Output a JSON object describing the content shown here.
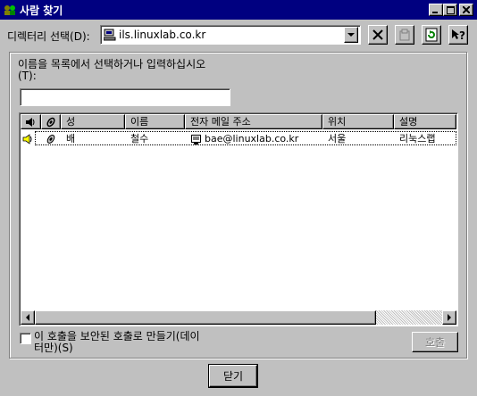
{
  "window": {
    "title": "사람 찾기"
  },
  "directory": {
    "label": "디렉터리 선택(D):",
    "value": "ils.linuxlab.co.kr"
  },
  "search": {
    "label": "이름을 목록에서 선택하거나 입력하십시오\n(T):",
    "value": ""
  },
  "table": {
    "columns": [
      "성",
      "이름",
      "전자 메일 주소",
      "위치",
      "설명"
    ],
    "rows": [
      {
        "last": "배",
        "first": "철수",
        "email": "bae@linuxlab.co.kr",
        "location": "서울",
        "description": "리눅스랩"
      }
    ]
  },
  "secure": {
    "label": "이 호출을 보안된 호출로 만들기(데이\n터만)(S)",
    "checked": false
  },
  "buttons": {
    "call": "호출",
    "close": "닫기"
  }
}
